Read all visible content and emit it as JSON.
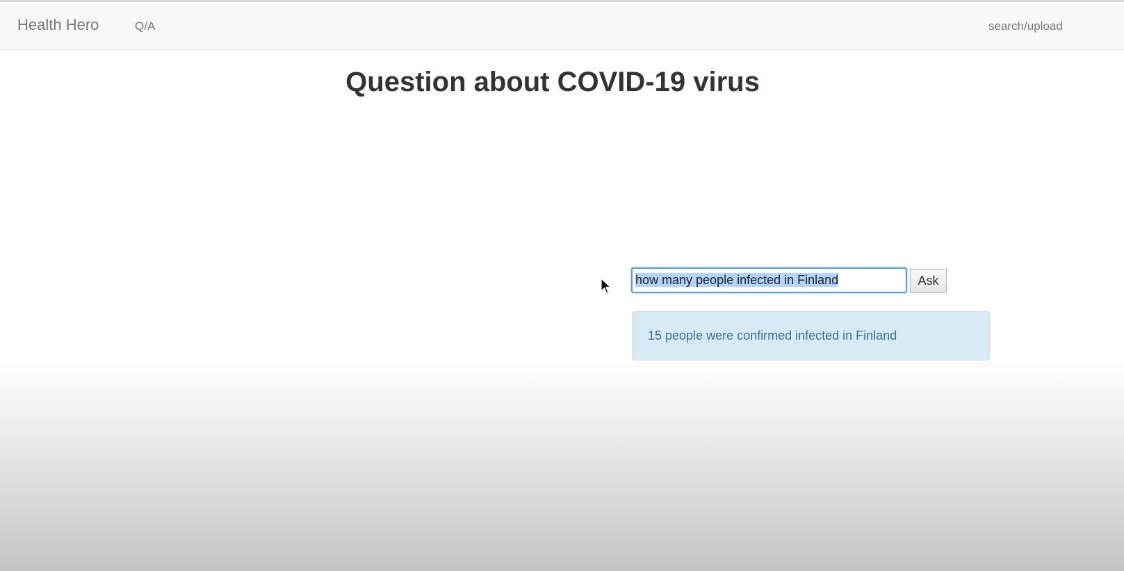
{
  "navbar": {
    "brand": "Health Hero",
    "links": [
      "Q/A",
      "search/upload"
    ]
  },
  "page": {
    "title": "Question about COVID-19 virus"
  },
  "question": {
    "value": "how many people infected in Finland"
  },
  "ask_button": {
    "label": "Ask"
  },
  "answer": {
    "text": "15 people were confirmed infected in Finland"
  },
  "colors": {
    "navbar_bg": "#f8f8f8",
    "answer_bg": "#d9eaf7",
    "answer_text": "#3a6f94",
    "input_focus_border": "#5b9dd9",
    "selection": "#b3d4fd"
  },
  "icons": [
    "mouse-cursor-icon"
  ]
}
